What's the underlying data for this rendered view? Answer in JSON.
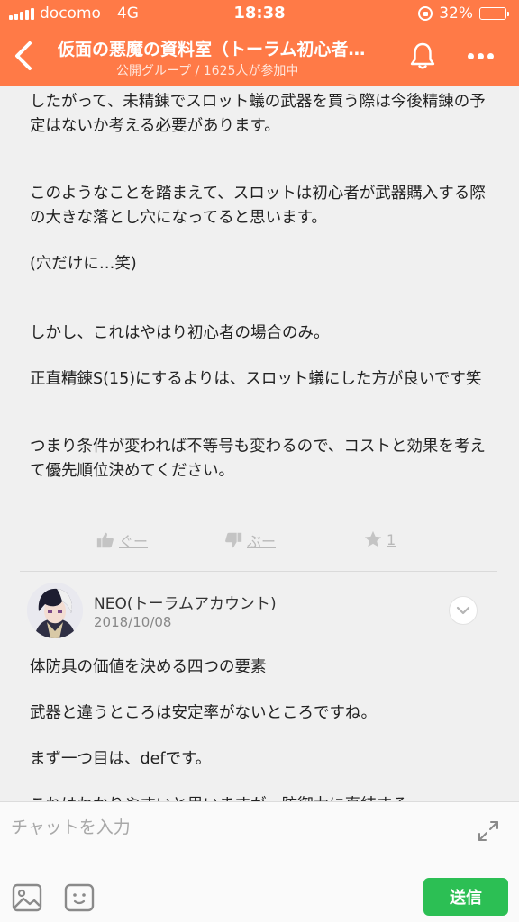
{
  "status_bar": {
    "carrier": "docomo",
    "network": "4G",
    "time": "18:38",
    "battery_text": "32%",
    "battery_level": 0.32
  },
  "header": {
    "title": "仮面の悪魔の資料室（トーラム初心者…",
    "subtitle": "公開グループ / 1625人が参加中"
  },
  "post": {
    "paragraphs": [
      "したがって、未精錬でスロット蟻の武器を買う際は今後精錬の予定はないか考える必要があります。",
      "このようなことを踏まえて、スロットは初心者が武器購入する際の大きな落とし穴になってると思います。",
      "(穴だけに…笑)",
      "しかし、これはやはり初心者の場合のみ。",
      "正直精錬S(15)にするよりは、スロット蟻にした方が良いです笑",
      "つまり条件が変われば不等号も変わるので、コストと効果を考えて優先順位決めてください。"
    ],
    "reactions": {
      "good_label": "ぐー",
      "boo_label": "ぶー",
      "star_count": "1"
    }
  },
  "next_post": {
    "author": "NEO(トーラムアカウント)",
    "date": "2018/10/08",
    "paragraphs": [
      "体防具の価値を決める四つの要素",
      "武器と違うところは安定率がないところですね。",
      "まず一つ目は、defです。",
      "これはわかりやすいと思いますが、防御力に直結する"
    ]
  },
  "input_bar": {
    "placeholder": "チャットを入力",
    "send_label": "送信"
  },
  "colors": {
    "header_bg": "#ff7a47",
    "send_bg": "#2cbf54",
    "content_bg": "#f0f0f0"
  }
}
